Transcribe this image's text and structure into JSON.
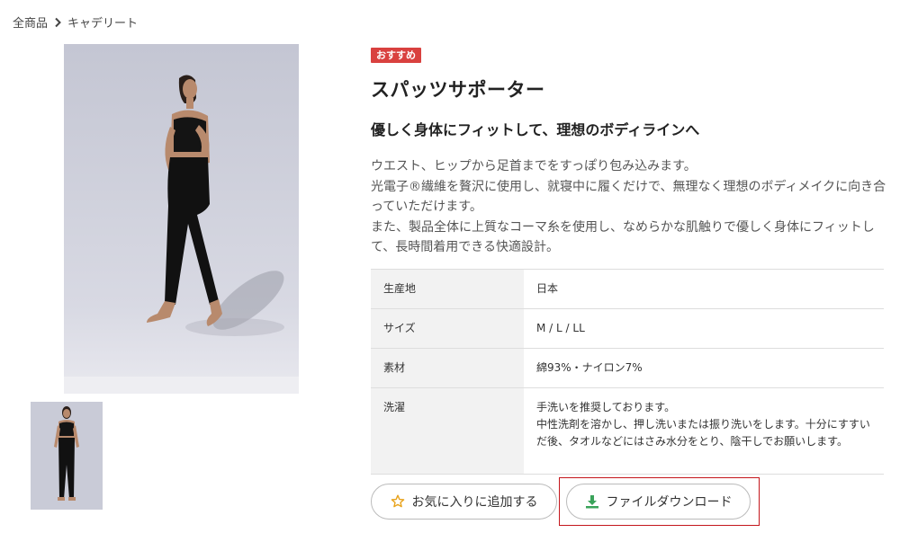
{
  "breadcrumb": {
    "items": [
      "全商品",
      "キャデリート"
    ]
  },
  "product": {
    "badge": "おすすめ",
    "title": "スパッツサポーター",
    "subtitle": "優しく身体にフィットして、理想のボディラインへ",
    "description": [
      "ウエスト、ヒップから足首までをすっぽり包み込みます。",
      "光電子®繊維を贅沢に使用し、就寝中に履くだけで、無理なく理想のボディメイクに向き合っていただけます。",
      "また、製品全体に上質なコーマ糸を使用し、なめらかな肌触りで優しく身体にフィットして、長時間着用できる快適設計。"
    ]
  },
  "specs": [
    {
      "label": "生産地",
      "value": "日本"
    },
    {
      "label": "サイズ",
      "value": "M / L / LL"
    },
    {
      "label": "素材",
      "value": "綿93%・ナイロン7%"
    },
    {
      "label": "洗濯",
      "value_lines": [
        "手洗いを推奨しております。",
        "中性洗剤を溶かし、押し洗いまたは振り洗いをします。十分にすすいだ後、タオルなどにはさみ水分をとり、陰干しでお願いします。"
      ]
    }
  ],
  "actions": {
    "favorite_label": "お気に入りに追加する",
    "download_label": "ファイルダウンロード"
  },
  "icons": {
    "breadcrumb_separator": "chevron-right-icon",
    "favorite": "star-icon",
    "download": "download-icon"
  },
  "colors": {
    "badge": "#d9413f",
    "star": "#e8a21a",
    "download_icon": "#3aa35a",
    "highlight_box": "#c4161c"
  }
}
